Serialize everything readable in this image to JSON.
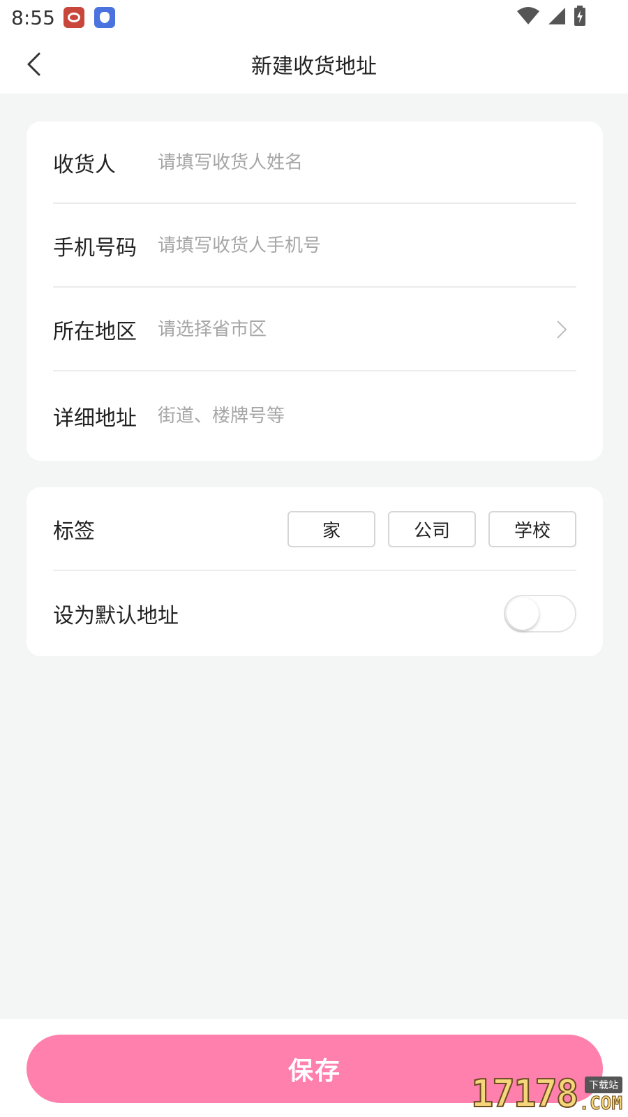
{
  "status_bar": {
    "time": "8:55",
    "icons": [
      "weibo-icon",
      "bird-app-icon",
      "wifi-icon",
      "cell-signal-icon",
      "battery-charging-icon"
    ]
  },
  "nav": {
    "title": "新建收货地址"
  },
  "form": {
    "receiver": {
      "label": "收货人",
      "placeholder": "请填写收货人姓名"
    },
    "phone": {
      "label": "手机号码",
      "placeholder": "请填写收货人手机号"
    },
    "region": {
      "label": "所在地区",
      "placeholder": "请选择省市区"
    },
    "detail": {
      "label": "详细地址",
      "placeholder": "街道、楼牌号等"
    }
  },
  "tags": {
    "label": "标签",
    "options": [
      "家",
      "公司",
      "学校"
    ]
  },
  "default_address": {
    "label": "设为默认地址",
    "enabled": false
  },
  "save": {
    "label": "保存"
  },
  "colors": {
    "accent": "#ff80ad",
    "background": "#f4f6f5"
  },
  "watermark": {
    "digits": "17178",
    "tag": "下载站",
    "suffix": ".COM"
  }
}
